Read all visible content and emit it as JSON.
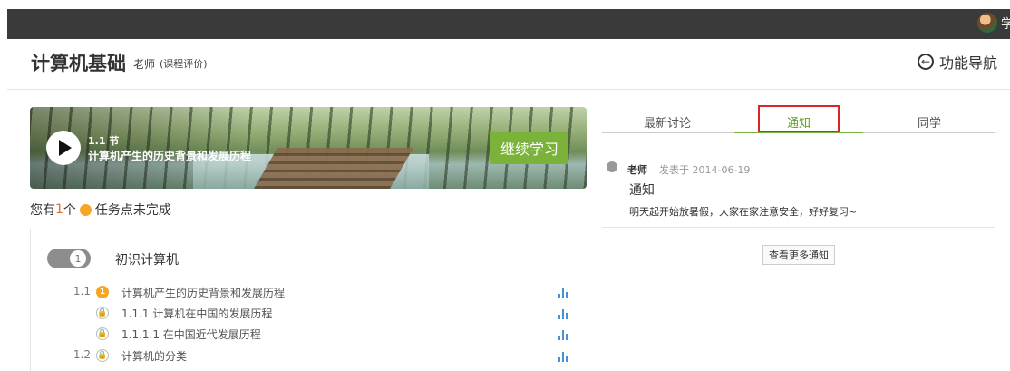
{
  "header": {
    "course_title": "计算机基础",
    "teacher": "老师",
    "review": "(课程评价)",
    "nav_label": "功能导航",
    "nav_icon": "←",
    "user_name": "学"
  },
  "banner": {
    "section_number": "1.1 节",
    "section_title": "计算机产生的历史背景和发展历程",
    "continue_label": "继续学习"
  },
  "task": {
    "prefix": "您有",
    "count": "1",
    "unit": "个",
    "suffix": "任务点未完成"
  },
  "chapter": {
    "number": "1",
    "title": "初识计算机",
    "rows": [
      {
        "num": "1.1",
        "status": "1",
        "label": "计算机产生的历史背景和发展历程"
      },
      {
        "num": "",
        "status": "🔒",
        "label": "1.1.1 计算机在中国的发展历程"
      },
      {
        "num": "",
        "status": "🔒",
        "label": "1.1.1.1 在中国近代发展历程"
      },
      {
        "num": "1.2",
        "status": "🔒",
        "label": "计算机的分类"
      }
    ]
  },
  "tabs": [
    "最新讨论",
    "通知",
    "同学"
  ],
  "notice": {
    "author": "老师",
    "date": "发表于 2014-06-19",
    "title": "通知",
    "body": "明天起开始放暑假，大家在家注意安全，好好复习~",
    "more_label": "查看更多通知"
  }
}
